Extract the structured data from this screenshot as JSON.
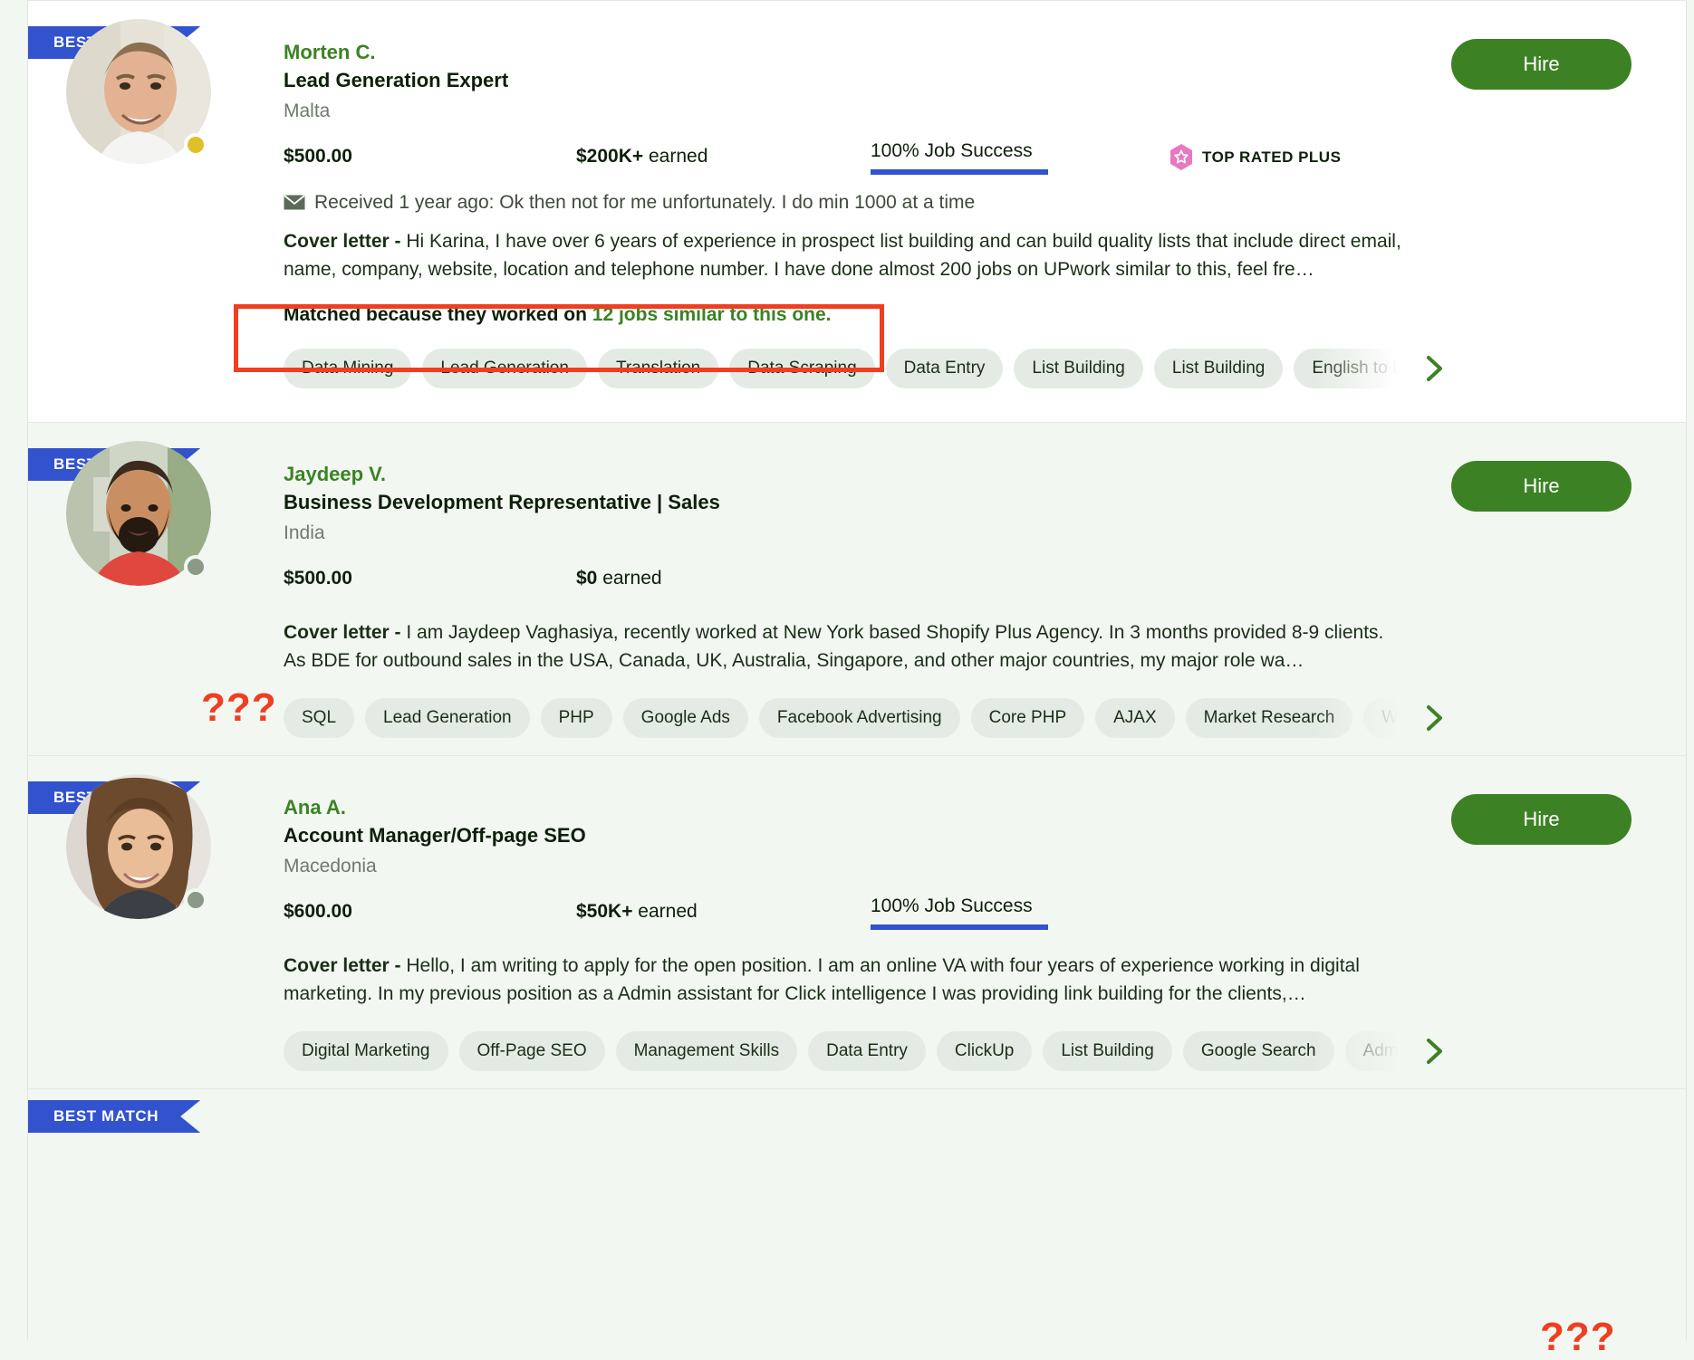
{
  "theme": {
    "page_bg": "#f2f7f2",
    "ribbon_blue": "#3252ce",
    "green": "#3c8224",
    "annotation_red": "#f03e20",
    "chip_bg": "#e4ebe4"
  },
  "ribbon_label": "BEST MATCH",
  "hire_label": "Hire",
  "cards": [
    {
      "name": "Morten C.",
      "title": "Lead Generation Expert",
      "location": "Malta",
      "rate": "$500.00",
      "earned_amount": "$200K+",
      "earned_suffix": " earned",
      "job_success": "100% Job Success",
      "badge": "TOP RATED PLUS",
      "status_color": "#e0c02a",
      "received": "Received 1 year ago: Ok then not for me unfortunately. I do min 1000 at a time",
      "cover_label": "Cover letter - ",
      "cover_text": "Hi Karina, I have over 6 years of experience in prospect list building and can build quality lists that include direct email, name, company, website, location and telephone number. I have done almost 200 jobs on UPwork similar to this, feel fre…",
      "matched_prefix": "Matched because they worked on ",
      "matched_link": "12 jobs similar to this one.",
      "skills": [
        "Data Mining",
        "Lead Generation",
        "Translation",
        "Data Scraping",
        "Data Entry",
        "List Building",
        "List Building",
        "English to Danish T"
      ]
    },
    {
      "name": "Jaydeep V.",
      "title": "Business Development Representative | Sales",
      "location": "India",
      "rate": "$500.00",
      "earned_amount": "$0",
      "earned_suffix": " earned",
      "job_success": "",
      "badge": "",
      "status_color": "#8a9a86",
      "received": "",
      "cover_label": "Cover letter - ",
      "cover_text": "I am Jaydeep Vaghasiya, recently worked at New York based Shopify Plus Agency. In 3 months provided 8-9 clients. As BDE for outbound sales in the USA, Canada, UK, Australia, Singapore, and other major countries, my major role wa…",
      "matched_prefix": "",
      "matched_link": "",
      "skills": [
        "SQL",
        "Lead Generation",
        "PHP",
        "Google Ads",
        "Facebook Advertising",
        "Core PHP",
        "AJAX",
        "Market Research",
        "Website Bui"
      ]
    },
    {
      "name": "Ana A.",
      "title": "Account Manager/Off-page SEO",
      "location": "Macedonia",
      "rate": "$600.00",
      "earned_amount": "$50K+",
      "earned_suffix": " earned",
      "job_success": "100% Job Success",
      "badge": "",
      "status_color": "#8a9a86",
      "received": "",
      "cover_label": "Cover letter - ",
      "cover_text": "Hello, I am writing to apply for the open position. I am an online VA with four years of experience working in digital marketing. In my previous position as a Admin assistant for Click intelligence I was providing link building for the clients,…",
      "matched_prefix": "",
      "matched_link": "",
      "skills": [
        "Digital Marketing",
        "Off-Page SEO",
        "Management Skills",
        "Data Entry",
        "ClickUp",
        "List Building",
        "Google Search",
        "Administrati"
      ]
    },
    {
      "name": "",
      "title": "",
      "location": "",
      "rate": "",
      "earned_amount": "",
      "earned_suffix": "",
      "job_success": "",
      "badge": "",
      "status_color": "",
      "received": "",
      "cover_label": "",
      "cover_text": "",
      "matched_prefix": "",
      "matched_link": "",
      "skills": []
    }
  ],
  "annotations": {
    "question_marks_card2": "???",
    "question_marks_card4": "???"
  }
}
